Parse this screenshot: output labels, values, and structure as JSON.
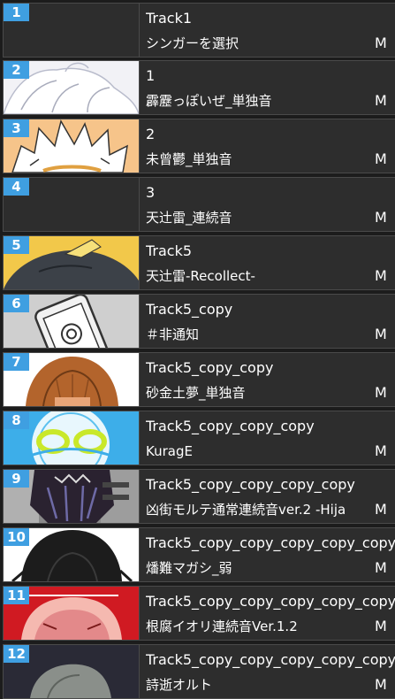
{
  "tracks": [
    {
      "number": "1",
      "name": "Track1",
      "singer": "シンガーを選択",
      "mute": "M",
      "thumb": "none"
    },
    {
      "number": "2",
      "name": "1",
      "singer": "霹靂っぽいぜ_単独音",
      "mute": "M",
      "thumb": "white-hair"
    },
    {
      "number": "3",
      "name": "2",
      "singer": "未曾鬱_単独音",
      "mute": "M",
      "thumb": "spiky-white-hair"
    },
    {
      "number": "4",
      "name": "3",
      "singer": "天辻雷_連続音",
      "mute": "M",
      "thumb": "none"
    },
    {
      "number": "5",
      "name": "Track5",
      "singer": "天辻雷-Recollect-",
      "mute": "M",
      "thumb": "dark-hair-yellow"
    },
    {
      "number": "6",
      "name": "Track5_copy",
      "singer": "＃非通知",
      "mute": "M",
      "thumb": "phone"
    },
    {
      "number": "7",
      "name": "Track5_copy_copy",
      "singer": "砂金土夢_単独音",
      "mute": "M",
      "thumb": "brown-hair"
    },
    {
      "number": "8",
      "name": "Track5_copy_copy_copy",
      "singer": "KuragE",
      "mute": "M",
      "thumb": "jellyfish"
    },
    {
      "number": "9",
      "name": "Track5_copy_copy_copy_copy",
      "singer": "凶街モルテ通常連続音ver.2 -Hija",
      "mute": "M",
      "thumb": "dark-character"
    },
    {
      "number": "10",
      "name": "Track5_copy_copy_copy_copy_copy",
      "singer": "燔難マガシ_弱",
      "mute": "M",
      "thumb": "black-hair"
    },
    {
      "number": "11",
      "name": "Track5_copy_copy_copy_copy_copy",
      "singer": "根腐イオリ連続音Ver.1.2",
      "mute": "M",
      "thumb": "red"
    },
    {
      "number": "12",
      "name": "Track5_copy_copy_copy_copy_copy",
      "singer": "詩逝オルト",
      "mute": "M",
      "thumb": "grey-hair"
    }
  ],
  "colors": {
    "badge": "#3f9fe1",
    "row_bg": "#2d2d2d",
    "row_border": "#4a4a4a",
    "text": "#ffffff"
  }
}
